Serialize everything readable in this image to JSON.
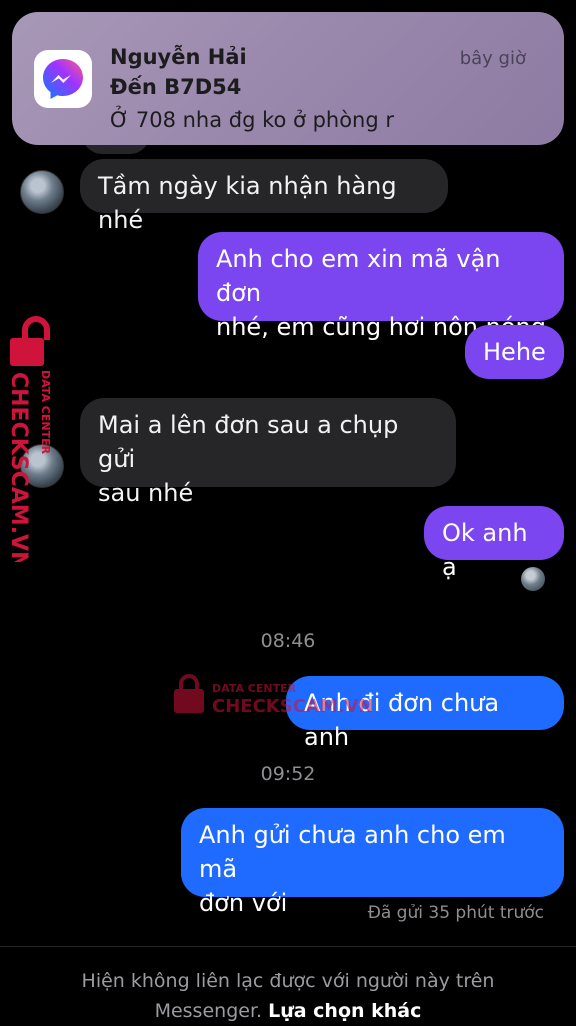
{
  "notification": {
    "sender": "Nguyễn Hải",
    "to": "Đến B7D54",
    "message": "Ở 708 nha đg ko ở phòng r",
    "time": "bây giờ",
    "app_icon": "messenger-icon"
  },
  "messages": {
    "m1": "Tầm ngày kia nhận hàng nhé",
    "m2_l1": "Anh cho em xin mã vận đơn",
    "m2_l2": "nhé, em cũng hơi nôn nóng",
    "m3": "Hehe",
    "m4_l1": "Mai a lên đơn sau a chụp gửi",
    "m4_l2": "sau nhé",
    "m5": "Ok anh ạ",
    "t1": "08:46",
    "m6": "Anh đi đơn chưa anh",
    "t2": "09:52",
    "m7_l1": "Anh gửi chưa anh cho em mã",
    "m7_l2": "đơn với",
    "status": "Đã gửi 35 phút trước"
  },
  "footer": {
    "line1": "Hiện không liên lạc được với người này trên",
    "line2_prefix": "Messenger.",
    "option": "Lựa chọn khác"
  },
  "watermark": {
    "vertical_brand": "CHECKSCAM.VN",
    "vertical_tag": "DATA CENTER",
    "mid_tag": "DATA CENTER",
    "mid_brand": "CHECKSCAM.VN"
  },
  "colors": {
    "incoming": "#262628",
    "outgoing_purple": "#7b46f0",
    "outgoing_blue": "#1f6bff",
    "watermark_red": "#d0133a"
  }
}
